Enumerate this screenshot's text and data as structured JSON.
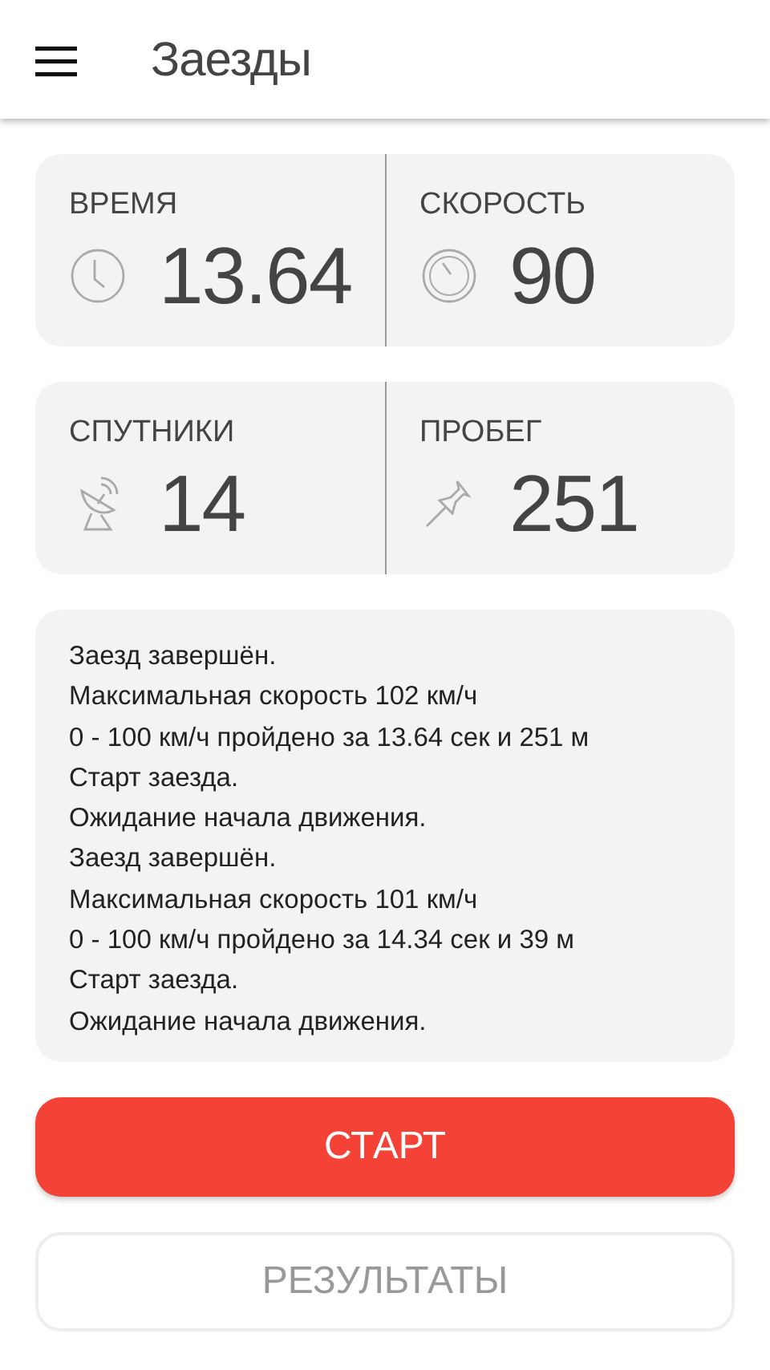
{
  "app_bar": {
    "title": "Заезды"
  },
  "stat_rows": [
    [
      {
        "kind": "time",
        "label": "ВРЕМЯ",
        "value": "13.64"
      },
      {
        "kind": "speed",
        "label": "СКОРОСТЬ",
        "value": "90"
      }
    ],
    [
      {
        "kind": "satellites",
        "label": "СПУТНИКИ",
        "value": "14"
      },
      {
        "kind": "distance",
        "label": "ПРОБЕГ",
        "value": "251"
      }
    ]
  ],
  "log": [
    "Заезд завершён.",
    "Максимальная скорость 102 км/ч",
    "0 - 100 км/ч пройдено за 13.64 сек и 251 м",
    "Старт заезда.",
    "Ожидание начала движения.",
    "Заезд завершён.",
    "Максимальная скорость 101 км/ч",
    "0 - 100 км/ч пройдено за 14.34 сек и 39 м",
    "Старт заезда.",
    "Ожидание начала движения."
  ],
  "buttons": [
    {
      "kind": "primary",
      "label": "СТАРТ",
      "disabled": false
    },
    {
      "kind": "outline",
      "label": "РЕЗУЛЬТАТЫ",
      "disabled": true
    }
  ]
}
